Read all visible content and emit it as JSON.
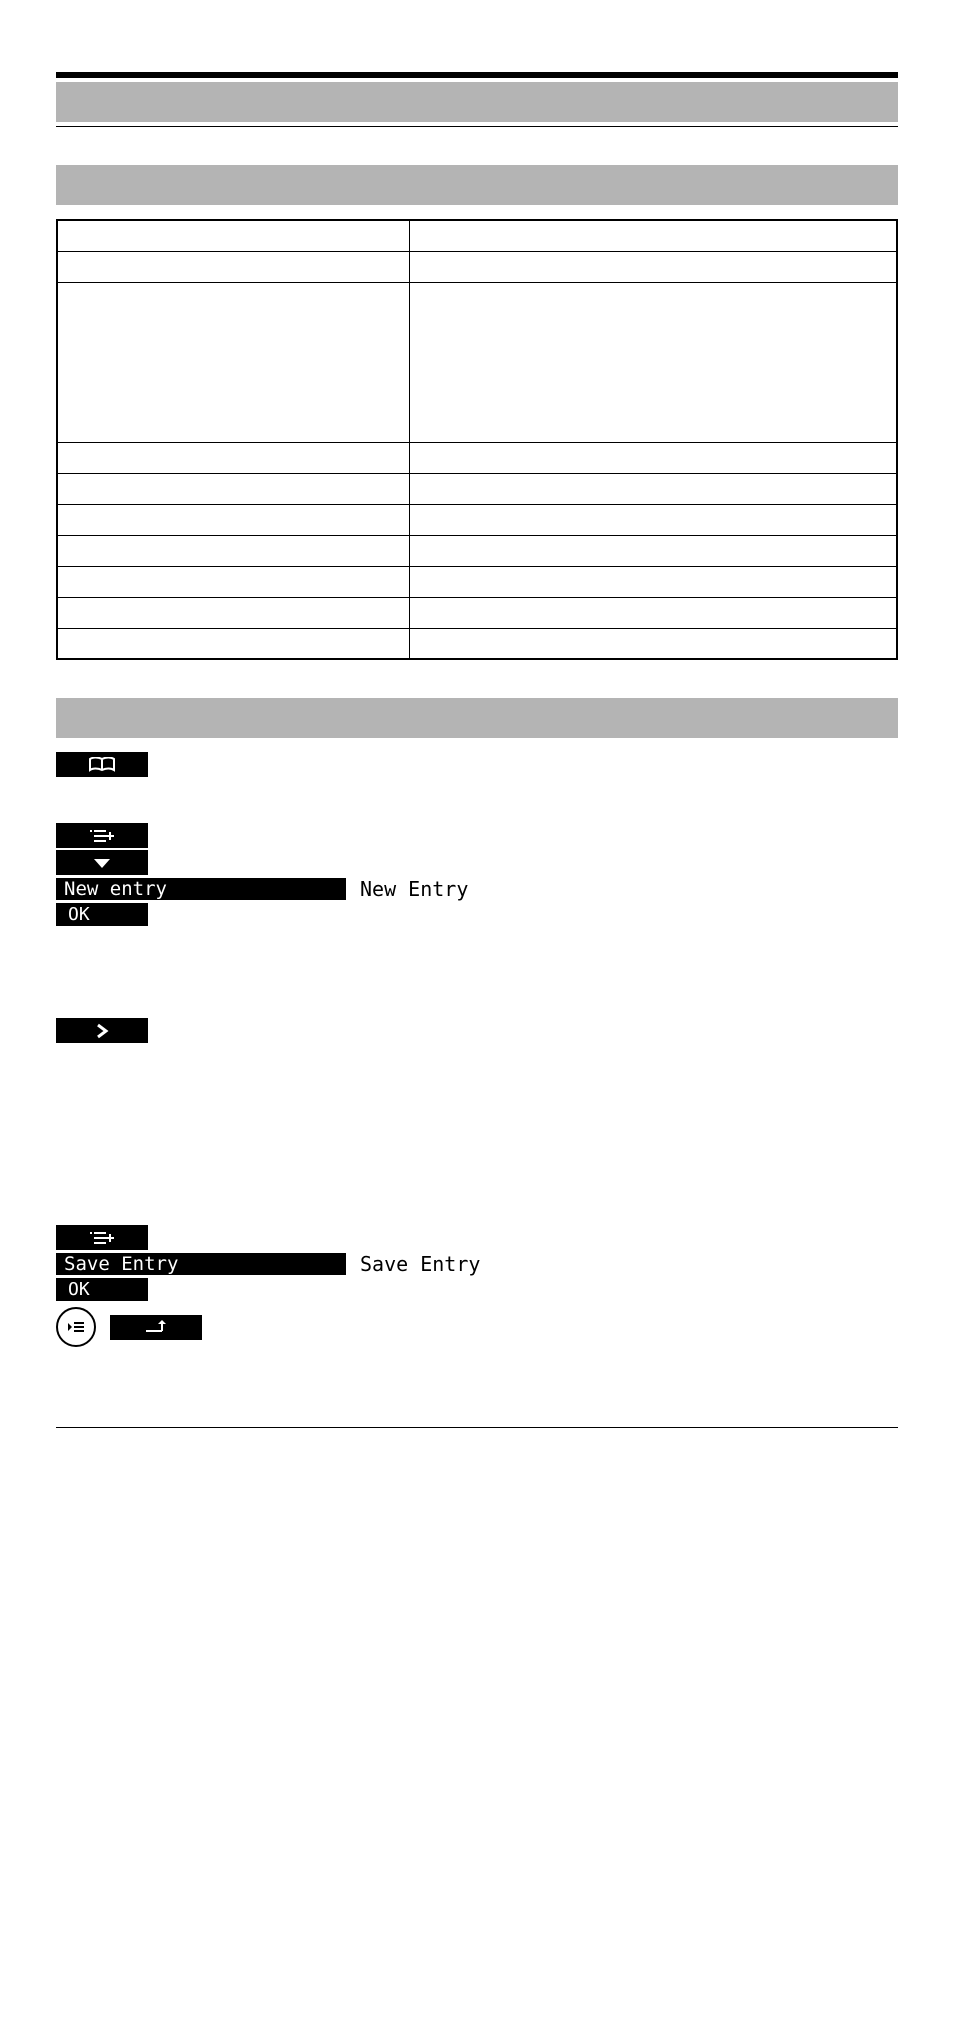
{
  "section1": {
    "heading_band": "",
    "table": {
      "r1c1": "",
      "r1c2": "",
      "r2c1": "",
      "r2c2": "",
      "r3c1": "",
      "r3c2": "",
      "r4c1": "",
      "r4c2": "",
      "r5c1": "",
      "r5c2": "",
      "r6c1": "",
      "r6c2": "",
      "r7c1": "",
      "r7c2": "",
      "r8c1": "",
      "r8c2": "",
      "r9c1": "",
      "r9c2": "",
      "r10c1": "",
      "r10c2": ""
    }
  },
  "procedure": {
    "heading_band": "",
    "steps": [
      {
        "kind": "icon-key",
        "icon": "open-book"
      },
      {
        "kind": "gap"
      },
      {
        "kind": "icon-key",
        "icon": "list-plus"
      },
      {
        "kind": "icon-key",
        "icon": "triangle-down"
      },
      {
        "kind": "state-text",
        "state": "New entry",
        "text": "New Entry"
      },
      {
        "kind": "text-key",
        "label": " OK"
      },
      {
        "kind": "para"
      },
      {
        "kind": "icon-key",
        "icon": "chevron-right"
      },
      {
        "kind": "para2"
      },
      {
        "kind": "icon-key",
        "icon": "list-plus"
      },
      {
        "kind": "state-text",
        "state": "Save Entry",
        "text": "Save Entry"
      },
      {
        "kind": "text-key",
        "label": " OK"
      },
      {
        "kind": "final-row"
      }
    ]
  }
}
